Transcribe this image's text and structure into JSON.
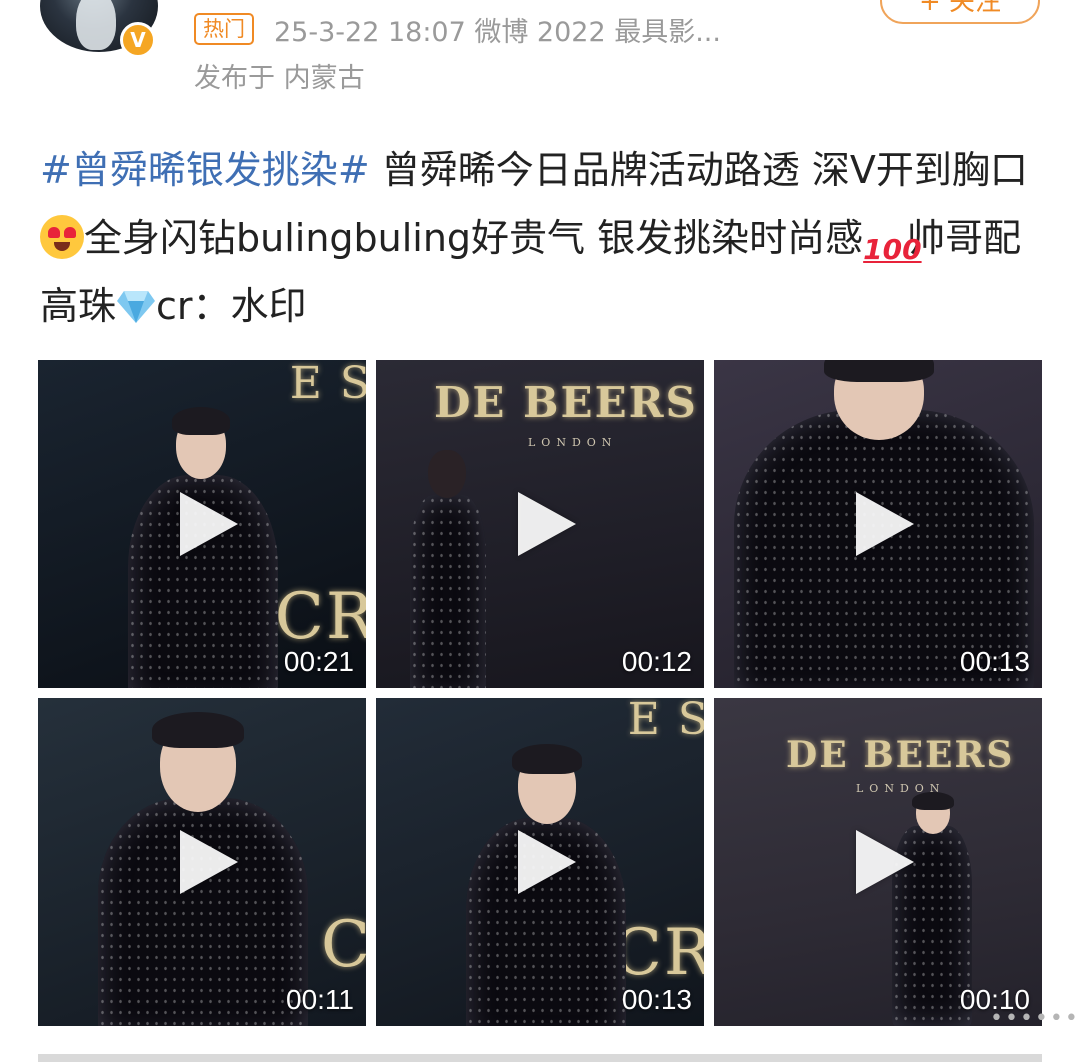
{
  "header": {
    "hot_label": "热门",
    "meta": "25-3-22 18:07  微博 2022 最具影...",
    "location": "发布于 内蒙古",
    "follow_label": "+ 关注",
    "verified_badge": "V",
    "accent_color": "#f08a24"
  },
  "post": {
    "topic": "#曾舜晞银发挑染#",
    "text_part1": " 曾舜晞今日品牌活动路透 深V开到胸口",
    "emoji1": "heart-eyes-emoji",
    "text_part2": "全身闪钻bulingbuling好贵气 银发挑染时尚感",
    "emoji2": "hundred-points-emoji",
    "text_part3": "帅哥配高珠",
    "emoji3": "gem-emoji",
    "text_part4": "cr：水印",
    "topic_color": "#3f6fb4"
  },
  "videos": [
    {
      "duration": "00:21",
      "sign_text": "E S",
      "sign_text2": "CR"
    },
    {
      "duration": "00:12",
      "sign_text": "DE BEERS",
      "sign_sub": "LONDON"
    },
    {
      "duration": "00:13"
    },
    {
      "duration": "00:11",
      "sign_text2": "C"
    },
    {
      "duration": "00:13",
      "sign_text": "E S",
      "sign_text2": "CR"
    },
    {
      "duration": "00:10",
      "sign_text": "DE BEERS",
      "sign_sub": "LONDON"
    }
  ]
}
